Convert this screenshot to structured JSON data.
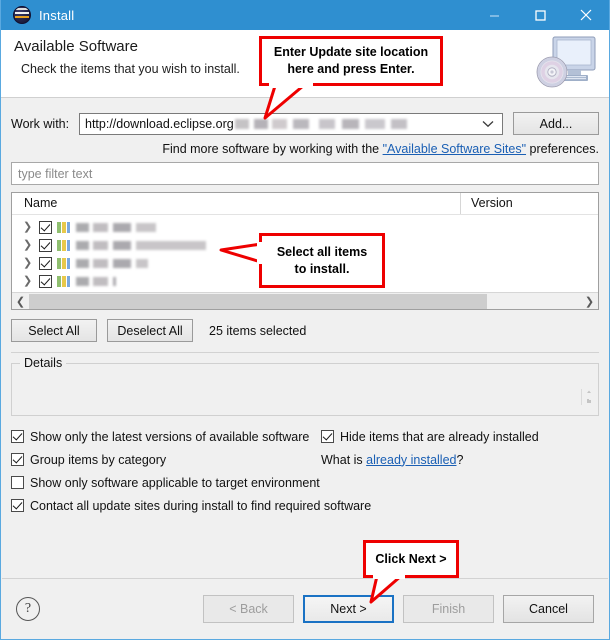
{
  "window": {
    "title": "Install",
    "icon": "eclipse-logo-icon",
    "controls": {
      "minimize": "minimize-icon",
      "maximize": "maximize-icon",
      "close": "close-icon"
    }
  },
  "header": {
    "title": "Available Software",
    "subtitle": "Check the items that you wish to install.",
    "graphic": "monitor-cd-icon"
  },
  "work_with": {
    "label": "Work with:",
    "value": "http://download.eclipse.org",
    "value_redacted": true,
    "dropdown_icon": "chevron-down-icon",
    "add_button": "Add..."
  },
  "find_more": {
    "prefix": "Find more software by working with the ",
    "link": "\"Available Software Sites\"",
    "suffix": " preferences."
  },
  "filter": {
    "placeholder": "type filter text",
    "value": ""
  },
  "tree": {
    "columns": [
      "Name",
      "Version"
    ],
    "rows": [
      {
        "name_redacted": true,
        "checked": true,
        "expandable": true,
        "icon": "feature-bars-icon",
        "version": "",
        "redact_width": 80
      },
      {
        "name_redacted": true,
        "checked": true,
        "expandable": true,
        "icon": "feature-bars-icon",
        "version": "",
        "redact_width": 130
      },
      {
        "name_redacted": true,
        "checked": true,
        "expandable": true,
        "icon": "feature-bars-icon",
        "version": "",
        "redact_width": 72
      },
      {
        "name_redacted": true,
        "checked": true,
        "expandable": true,
        "icon": "feature-bars-icon",
        "version": "",
        "redact_width": 40
      }
    ],
    "scrollbar": {
      "left_arrow": "chevron-left-icon",
      "right_arrow": "chevron-right-icon",
      "thumb_percent": 83
    }
  },
  "selection_bar": {
    "select_all": "Select All",
    "deselect_all": "Deselect All",
    "count_text": "25 items selected"
  },
  "details": {
    "legend": "Details",
    "content": "",
    "grip_icon": "resize-grip-icon"
  },
  "options": [
    {
      "label": "Show only the latest versions of available software",
      "checked": true,
      "column": "left"
    },
    {
      "label": "Hide items that are already installed",
      "checked": true,
      "column": "right"
    },
    {
      "label": "Group items by category",
      "checked": true,
      "column": "left"
    },
    {
      "label": "Show only software applicable to target environment",
      "checked": false,
      "column": "left"
    },
    {
      "label": "Contact all update sites during install to find required software",
      "checked": true,
      "column": "left"
    }
  ],
  "what_is": {
    "prefix": "What is ",
    "link": "already installed",
    "suffix": "?"
  },
  "footer": {
    "help_icon": "question-mark-icon",
    "buttons": [
      {
        "label": "< Back",
        "state": "disabled"
      },
      {
        "label": "Next >",
        "state": "default-focused"
      },
      {
        "label": "Finish",
        "state": "disabled"
      },
      {
        "label": "Cancel",
        "state": "enabled"
      }
    ]
  },
  "callouts": [
    {
      "id": "url",
      "line1": "Enter Update site location",
      "line2": "here and press Enter."
    },
    {
      "id": "items",
      "line1": "Select all items",
      "line2": "to install."
    },
    {
      "id": "next",
      "line1": "Click Next >",
      "line2": ""
    }
  ],
  "colors": {
    "titlebar": "#2f8fd0",
    "callout_border": "#ee0000",
    "link": "#1a5fb4",
    "focus_border": "#1a72c4",
    "dialog_bg": "#f0f0f0"
  }
}
